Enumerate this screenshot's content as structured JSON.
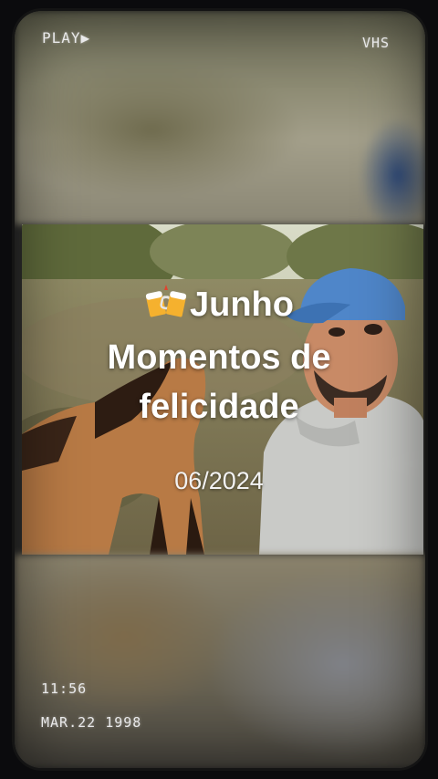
{
  "overlay": {
    "play_label": "PLAY",
    "play_icon": "play-triangle-icon",
    "vhs_label": "VHS",
    "time": "11:56",
    "date_stamp": "MAR.22 1998"
  },
  "caption": {
    "emoji_icon": "beer-mugs-icon",
    "title_line1": "Junho",
    "title_line2": "Momentos de",
    "title_line3": "felicidade",
    "date": "06/2024"
  }
}
